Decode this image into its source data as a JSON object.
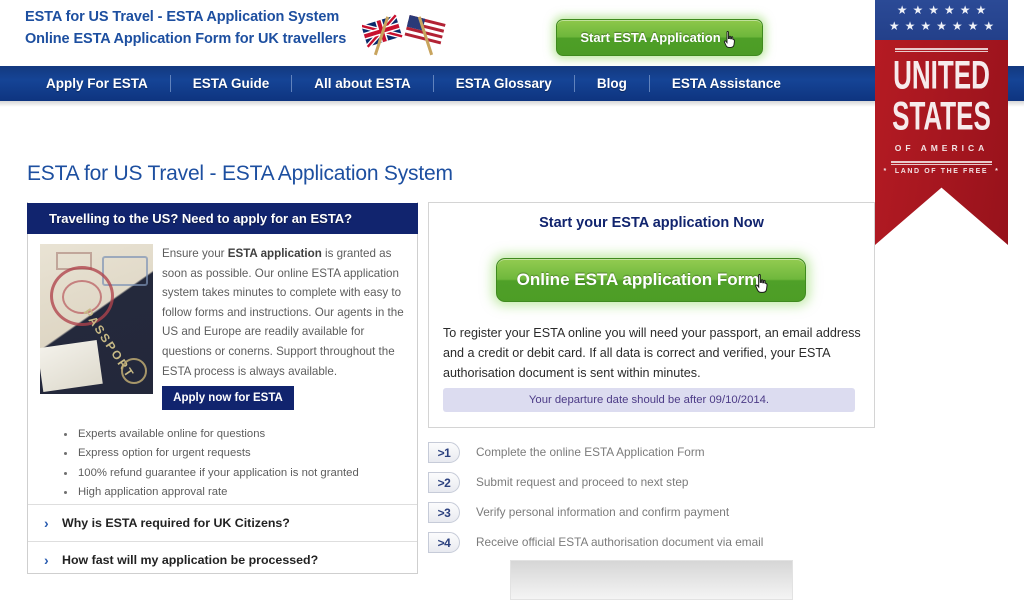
{
  "header": {
    "brand_line1": "ESTA for US Travel - ESTA Application System",
    "brand_line2": "Online ESTA Application Form for UK travellers",
    "flags_icon": "uk-us-crossed-flags-icon",
    "start_button": "Start ESTA Application",
    "cursor_icon": "hand-pointer-cursor-icon"
  },
  "nav": {
    "items": [
      "Apply For ESTA",
      "ESTA Guide",
      "All about ESTA",
      "ESTA Glossary",
      "Blog",
      "ESTA Assistance"
    ]
  },
  "banner": {
    "united": "UNITED",
    "states": "STATES",
    "of_america": "OF AMERICA",
    "land_of_the_free": "LAND OF THE FREE",
    "star": "★",
    "star_count_row1": 6,
    "star_count_row2": 7,
    "colors": {
      "blue": "#2b4a96",
      "red": "#a81720"
    }
  },
  "main": {
    "page_title": "ESTA for US Travel - ESTA Application System"
  },
  "left_card": {
    "heading": "Travelling to the US? Need to apply for an ESTA?",
    "image_name": "passport-photo",
    "body_pre": "Ensure your ",
    "body_bold": "ESTA application",
    "body_post": " is granted as soon as possible. Our online ESTA application system takes minutes to complete with easy to follow forms and instructions. Our agents in the US and Europe are readily available for questions or conerns. Support throughout the ESTA process is always available.",
    "apply_button": "Apply now for ESTA",
    "features": [
      "Experts available online for questions",
      "Express option for urgent requests",
      "100% refund guarantee if your application is not granted",
      "High application approval rate"
    ],
    "accordion": [
      {
        "chevron": "›",
        "label": "Why is ESTA required for UK Citizens?"
      },
      {
        "chevron": "›",
        "label": "How fast will my application be processed?"
      }
    ]
  },
  "right_card": {
    "title": "Start your ESTA application Now",
    "form_button": "Online ESTA application Form",
    "cursor_icon": "hand-pointer-cursor-icon",
    "paragraph": "To register your ESTA online you will need your passport, an email address and a credit or debit card. If all data is correct and verified, your ESTA authorisation document is sent within minutes.",
    "notice": "Your departure date should be after 09/10/2014."
  },
  "steps": [
    {
      "number": ">1",
      "text": "Complete the online ESTA Application Form"
    },
    {
      "number": ">2",
      "text": "Submit request and proceed to next step"
    },
    {
      "number": ">3",
      "text": "Verify personal information and confirm payment"
    },
    {
      "number": ">4",
      "text": "Receive official ESTA authorisation document via email"
    }
  ],
  "colors": {
    "brand_blue": "#1d4fa0",
    "nav_blue": "#154496",
    "dark_blue": "#11246e",
    "green": "#6db73b",
    "notice_bg": "#dcdcf0"
  }
}
